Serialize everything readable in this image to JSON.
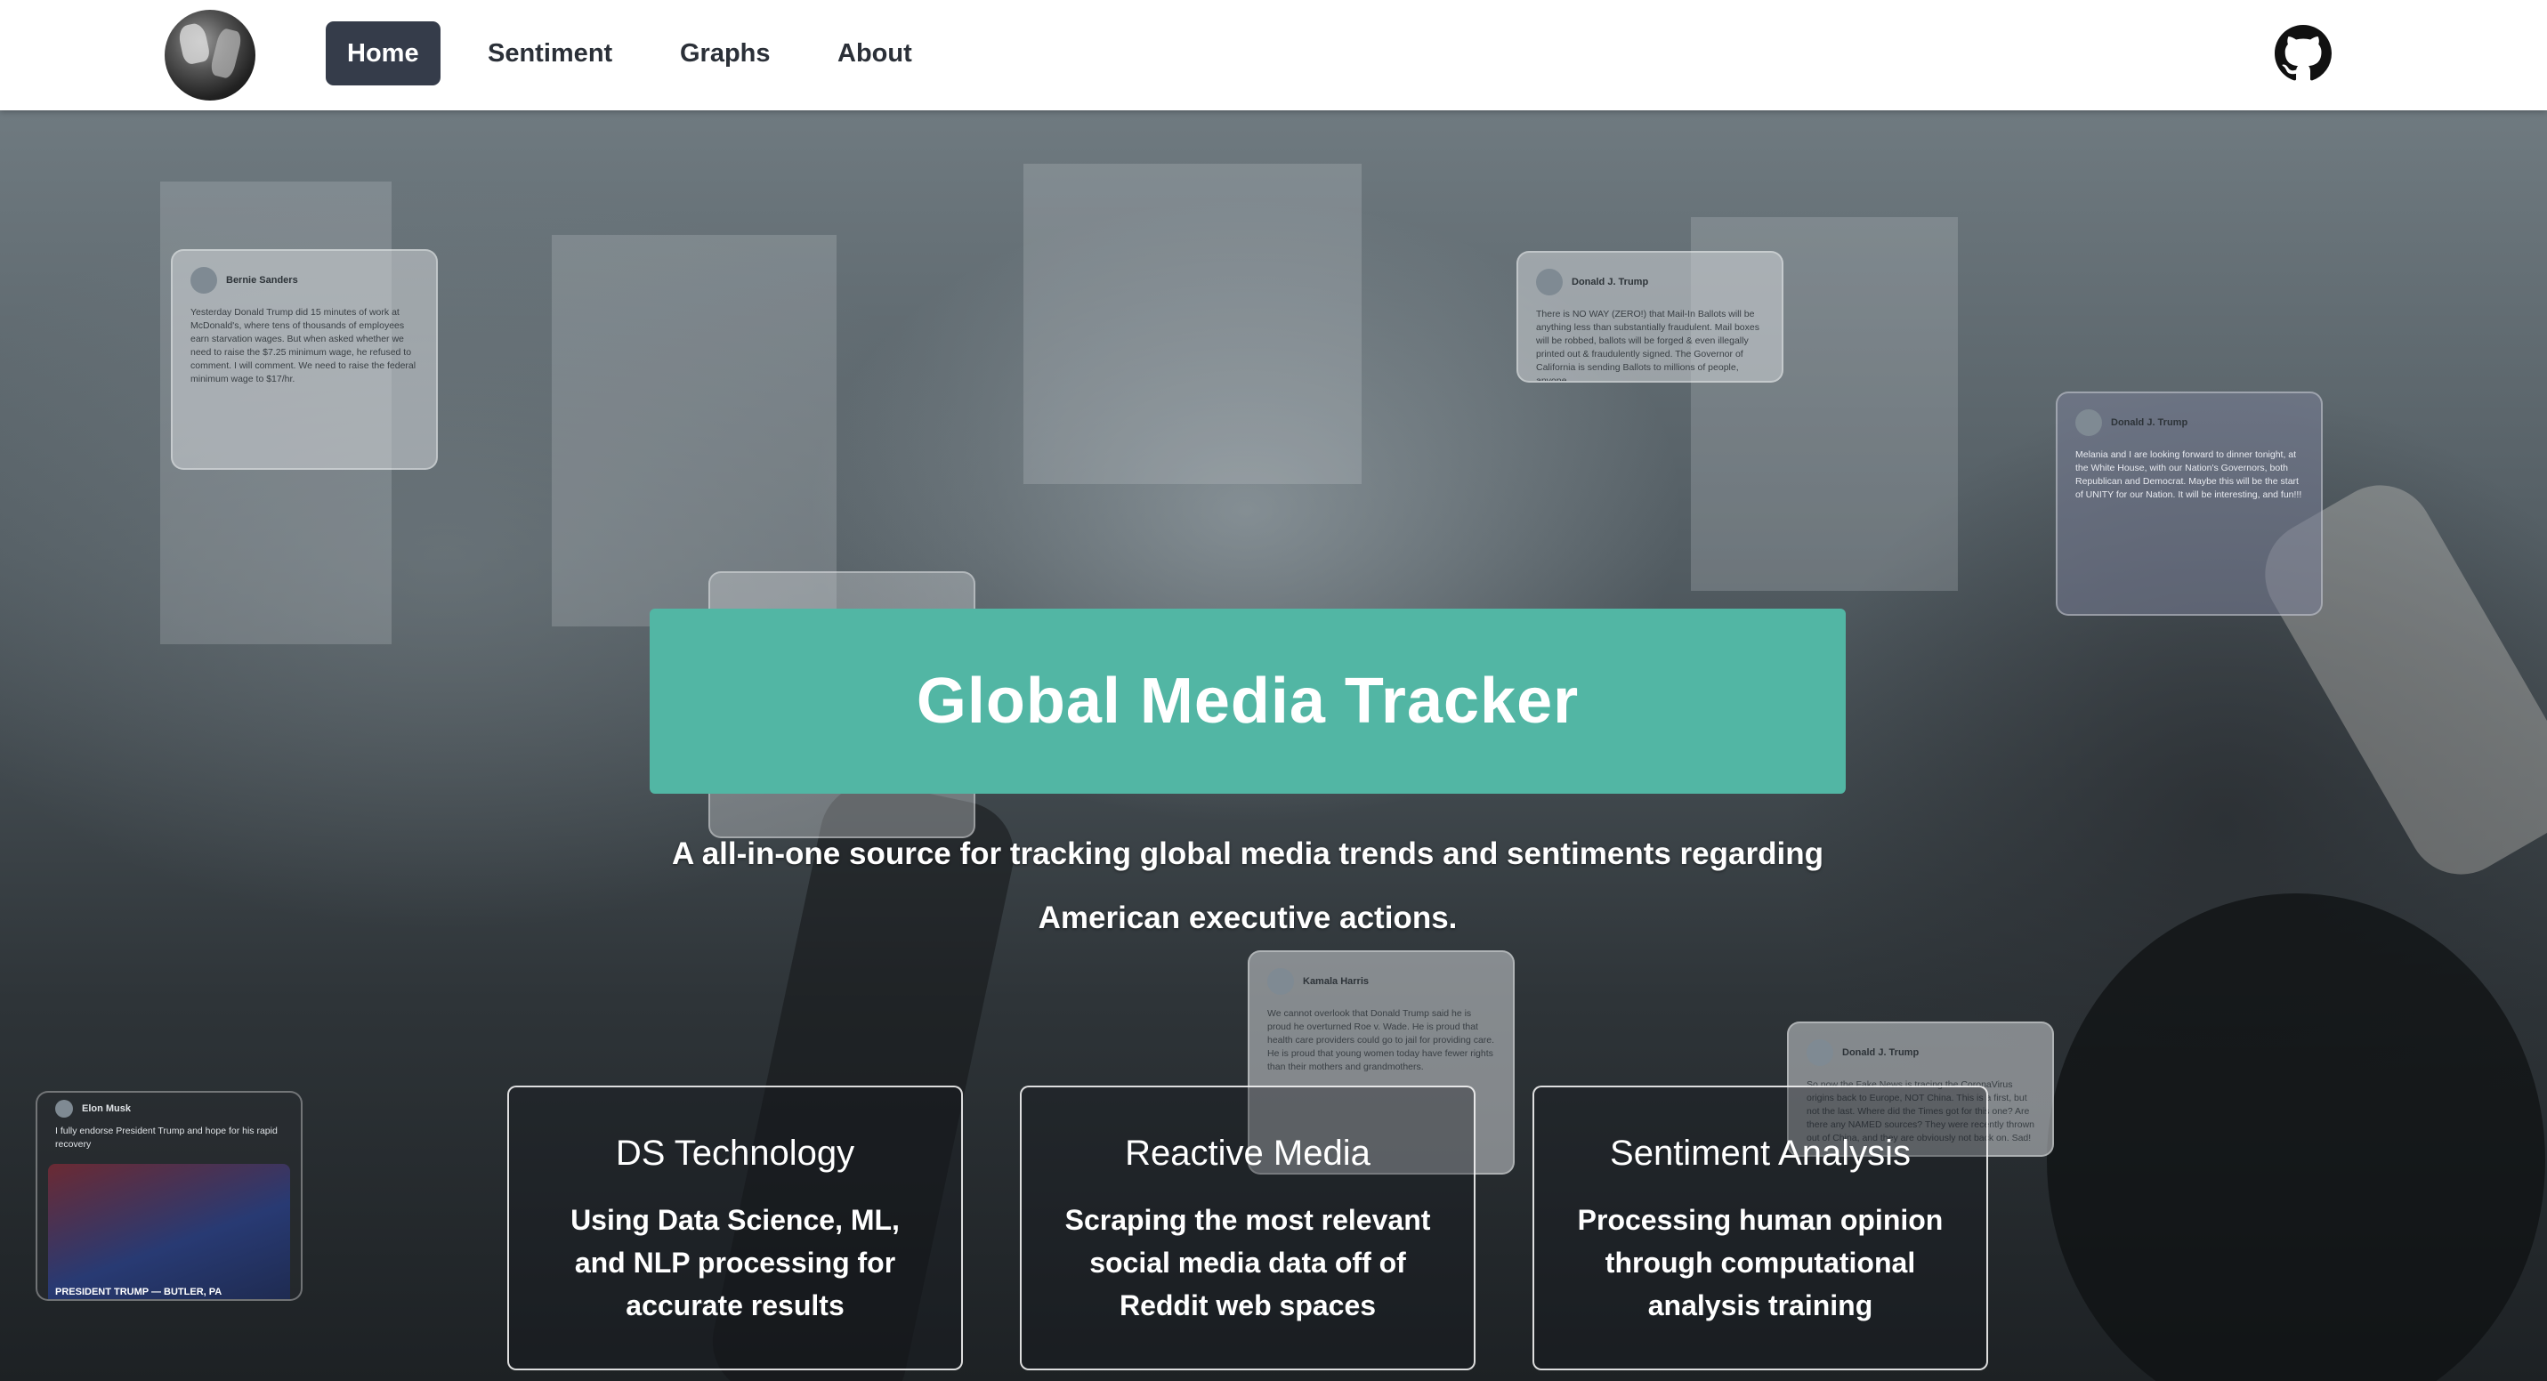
{
  "nav": {
    "logo": "site-logo",
    "links": [
      "Home",
      "Sentiment",
      "Graphs",
      "About"
    ],
    "active": "Home",
    "github_icon": "github-icon"
  },
  "hero": {
    "title": "Global Media Tracker",
    "subtitle": "A all-in-one source for tracking global media trends and sentiments regarding American executive actions."
  },
  "cards": [
    {
      "title": "DS Technology",
      "text": "Using Data Science, ML, and NLP processing for accurate results"
    },
    {
      "title": "Reactive Media",
      "text": "Scraping the most relevant social media data off of Reddit web spaces"
    },
    {
      "title": "Sentiment Analysis",
      "text": "Processing human opinion through computational analysis training"
    }
  ],
  "tweets": {
    "sanders": {
      "name": "Bernie Sanders",
      "body": "Yesterday Donald Trump did 15 minutes of work at McDonald's, where tens of thousands of employees earn starvation wages. But when asked whether we need to raise the $7.25 minimum wage, he refused to comment. I will comment. We need to raise the federal minimum wage to $17/hr."
    },
    "trump_mail": {
      "name": "Donald J. Trump",
      "body": "There is NO WAY (ZERO!) that Mail-In Ballots will be anything less than substantially fraudulent. Mail boxes will be robbed, ballots will be forged & even illegally printed out & fraudulently signed. The Governor of California is sending Ballots to millions of people, anyone..."
    },
    "trump_dinner": {
      "name": "Donald J. Trump",
      "body": "Melania and I are looking forward to dinner tonight, at the White House, with our Nation's Governors, both Republican and Democrat. Maybe this will be the start of UNITY for our Nation. It will be interesting, and fun!!!"
    },
    "harris": {
      "name": "Kamala Harris",
      "body": "We cannot overlook that Donald Trump said he is proud he overturned Roe v. Wade. He is proud that health care providers could go to jail for providing care. He is proud that young women today have fewer rights than their mothers and grandmothers."
    },
    "trump_fake": {
      "name": "Donald J. Trump",
      "body": "So now the Fake News is tracing the CoronaVirus origins back to Europe, NOT China. This is a first, but not the last. Where did the Times got for this one? Are there any NAMED sources? They were recently thrown out of China, and they are obviously not back on. Sad!"
    },
    "musk": {
      "name": "Elon Musk",
      "body": "I fully endorse President Trump and hope for his rapid recovery",
      "photo_caption": "PRESIDENT TRUMP — BUTLER, PA"
    }
  }
}
